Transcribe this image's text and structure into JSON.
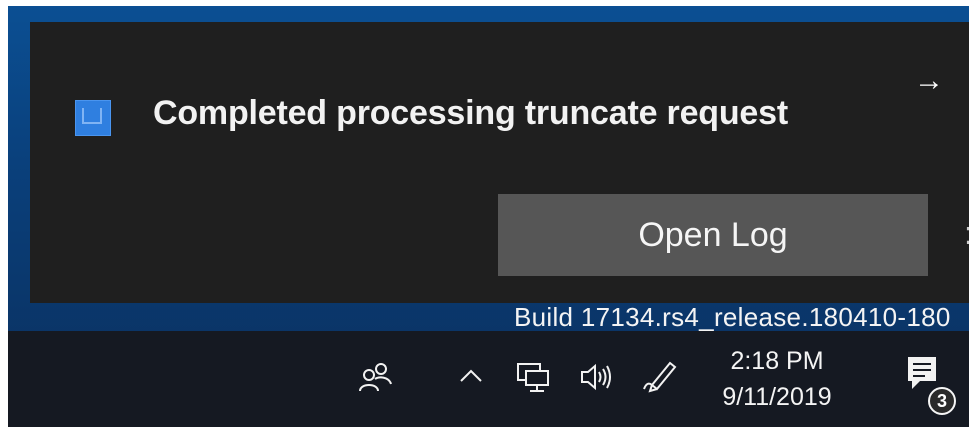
{
  "toast": {
    "app_icon": "app-window-icon",
    "title": "Completed processing truncate request",
    "expand_icon": "arrow-right-icon",
    "expand_glyph": "→",
    "action_label": "Open Log",
    "partial_glyph": ":"
  },
  "desktop": {
    "build_info": "Build 17134.rs4_release.180410-180"
  },
  "taskbar": {
    "icons": [
      "people-icon",
      "chevron-up-icon",
      "network-icon",
      "volume-icon",
      "pen-icon"
    ],
    "chevron_glyph": "^",
    "time": "2:18 PM",
    "date": "9/11/2019",
    "notification_count": "3"
  },
  "colors": {
    "toast_bg": "#1f1f1f",
    "button_bg": "#565656",
    "taskbar_bg": "#151922",
    "accent": "#2f7fe0"
  }
}
